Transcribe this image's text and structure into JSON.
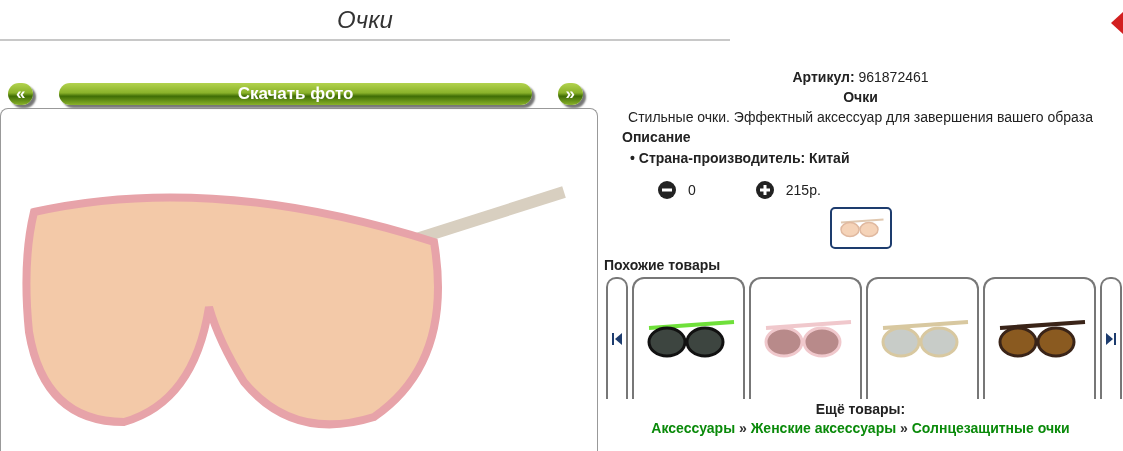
{
  "header": {
    "title": "Очки"
  },
  "gallery": {
    "prev": "«",
    "download": "Скачать фото",
    "next": "»"
  },
  "product": {
    "article_label": "Артикул:",
    "article": "961872461",
    "name": "Очки",
    "tagline": "Стильные очки. Эффектный аксессуар для завершения вашего образа",
    "description_heading": "Описание",
    "properties": [
      {
        "bullet": "•",
        "text": "Страна-производитель: Китай"
      }
    ],
    "quantity": "0",
    "price": "215р."
  },
  "similar": {
    "heading": "Похожие товары"
  },
  "more": {
    "heading": "Ещё товары:",
    "separator": "»",
    "links": [
      "Аксессуары",
      "Женские аксессуары",
      "Солнцезащитные очки"
    ]
  }
}
